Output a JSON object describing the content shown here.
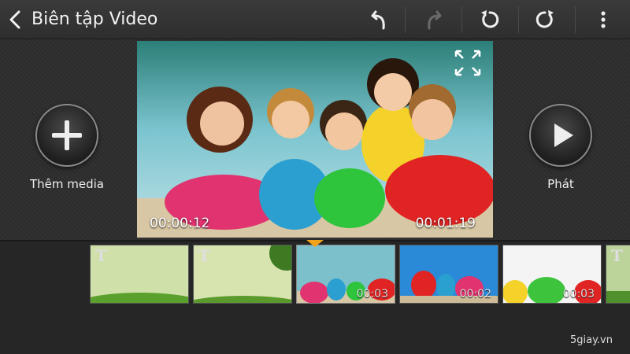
{
  "topbar": {
    "title": "Biên tập Video",
    "buttons": [
      "undo-icon",
      "redo-icon",
      "rotate-left-icon",
      "rotate-right-icon",
      "more-vertical-icon"
    ]
  },
  "main": {
    "add_media_label": "Thêm media",
    "play_label": "Phát",
    "preview": {
      "time_current": "00:00:12",
      "time_total": "00:01:19"
    }
  },
  "timeline": {
    "clips": [
      {
        "type": "title",
        "label": "T",
        "time": ""
      },
      {
        "type": "title",
        "label": "T",
        "time": ""
      },
      {
        "type": "photo",
        "label": "",
        "time": "00:03"
      },
      {
        "type": "photo",
        "label": "",
        "time": "00:02"
      },
      {
        "type": "photo",
        "label": "",
        "time": "00:03"
      },
      {
        "type": "title",
        "label": "T",
        "time": ""
      }
    ]
  },
  "watermark": "5giay.vn",
  "colors": {
    "accent": "#f2a11a",
    "background": "#2b2b2b"
  }
}
